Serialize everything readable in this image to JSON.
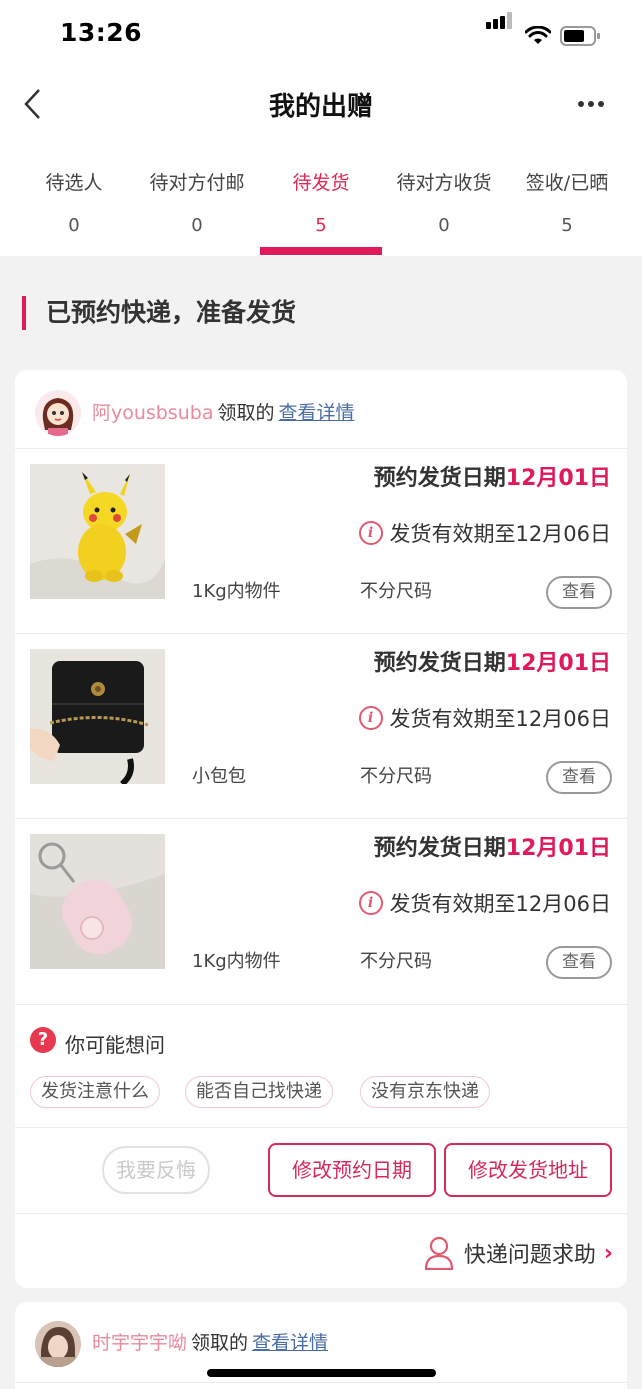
{
  "status_bar": {
    "time": "13:26"
  },
  "nav": {
    "title": "我的出赠"
  },
  "tabs": [
    {
      "label": "待选人",
      "count": "0"
    },
    {
      "label": "待对方付邮",
      "count": "0"
    },
    {
      "label": "待发货",
      "count": "5",
      "active": true
    },
    {
      "label": "待对方收货",
      "count": "0"
    },
    {
      "label": "签收/已晒",
      "count": "5"
    }
  ],
  "section": {
    "title": "已预约快递，准备发货"
  },
  "cards": [
    {
      "user": "阿yousbsuba",
      "claimed": "领取的",
      "detail_link": "查看详情",
      "items": [
        {
          "date_prefix": "预约发货日期",
          "date": "12月01日",
          "valid": "发货有效期至12月06日",
          "name": "1Kg内物件",
          "size": "不分尺码",
          "view": "查看",
          "image": "pikachu-figurine"
        },
        {
          "date_prefix": "预约发货日期",
          "date": "12月01日",
          "valid": "发货有效期至12月06日",
          "name": "小包包",
          "size": "不分尺码",
          "view": "查看",
          "image": "black-handbag"
        },
        {
          "date_prefix": "预约发货日期",
          "date": "12月01日",
          "valid": "发货有效期至12月06日",
          "name": "1Kg内物件",
          "size": "不分尺码",
          "view": "查看",
          "image": "pink-keychain"
        }
      ],
      "faq": {
        "title": "你可能想问",
        "chips": [
          "发货注意什么",
          "能否自己找快递",
          "没有京东快递"
        ]
      },
      "actions": {
        "regret": "我要反悔",
        "change_date": "修改预约日期",
        "change_address": "修改发货地址"
      },
      "help": {
        "label": "快递问题求助"
      }
    },
    {
      "user": "时宇宇宇呦",
      "claimed": "领取的",
      "detail_link": "查看详情"
    }
  ],
  "colors": {
    "accent": "#e0195a",
    "link": "#4a6da7",
    "username": "#e88a9c"
  }
}
